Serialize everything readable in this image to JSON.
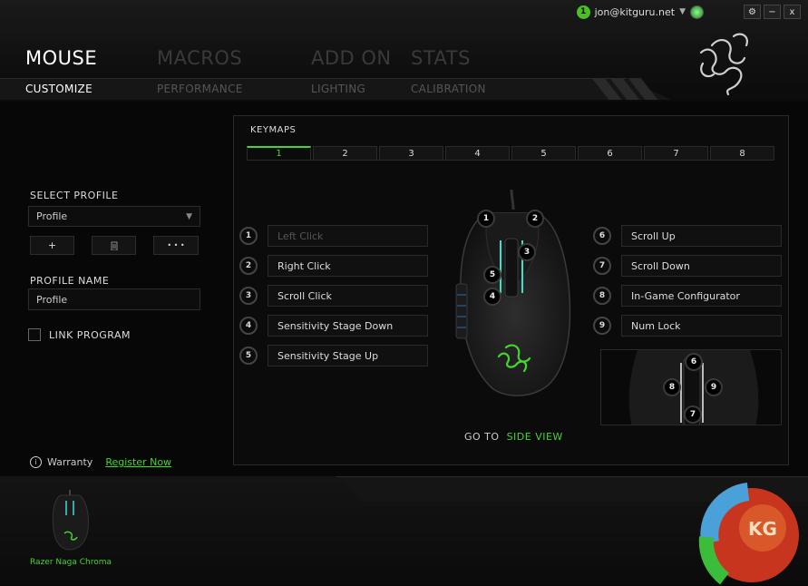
{
  "user": {
    "badge": "1",
    "email": "jon@kitguru.net",
    "dropdown": "▼"
  },
  "window": {
    "settings": "⚙",
    "minimize": "−",
    "close": "x"
  },
  "nav": {
    "main": [
      {
        "label": "MOUSE",
        "active": true
      },
      {
        "label": "MACROS",
        "active": false
      },
      {
        "label": "ADD ON",
        "active": false
      },
      {
        "label": "STATS",
        "active": false
      }
    ],
    "sub": [
      {
        "label": "CUSTOMIZE",
        "active": true
      },
      {
        "label": "PERFORMANCE",
        "active": false
      },
      {
        "label": "LIGHTING",
        "active": false
      },
      {
        "label": "CALIBRATION",
        "active": false
      }
    ]
  },
  "profile": {
    "select_label": "SELECT PROFILE",
    "selected": "Profile",
    "add_btn": "+",
    "delete_btn": "🗑",
    "more_btn": "• • •",
    "name_label": "PROFILE NAME",
    "name_value": "Profile",
    "link_program_label": "LINK PROGRAM"
  },
  "keymaps": {
    "title": "KEYMAPS",
    "tabs": [
      "1",
      "2",
      "3",
      "4",
      "5",
      "6",
      "7",
      "8"
    ],
    "active_tab": "1",
    "left_keys": [
      {
        "num": "1",
        "label": "Left Click"
      },
      {
        "num": "2",
        "label": "Right Click"
      },
      {
        "num": "3",
        "label": "Scroll Click"
      },
      {
        "num": "4",
        "label": "Sensitivity Stage Down"
      },
      {
        "num": "5",
        "label": "Sensitivity Stage Up"
      }
    ],
    "right_keys": [
      {
        "num": "6",
        "label": "Scroll Up"
      },
      {
        "num": "7",
        "label": "Scroll Down"
      },
      {
        "num": "8",
        "label": "In-Game Configurator"
      },
      {
        "num": "9",
        "label": "Num Lock"
      }
    ],
    "mouse_markers": [
      "1",
      "2",
      "3",
      "5",
      "4"
    ],
    "side_markers": [
      "6",
      "8",
      "9",
      "7"
    ],
    "goto_prefix": "GO TO",
    "goto_link": "SIDE VIEW"
  },
  "footer": {
    "warranty_label": "Warranty",
    "register_link": "Register Now",
    "device_name": "Razer Naga Chroma",
    "watermark": "KG"
  },
  "colors": {
    "accent": "#44d62c",
    "background": "#070707"
  },
  "icons": [
    "razer-logo-icon",
    "settings-gear-icon",
    "minimize-icon",
    "close-icon",
    "sync-icon",
    "trash-icon",
    "info-icon",
    "dropdown-arrow-icon"
  ]
}
